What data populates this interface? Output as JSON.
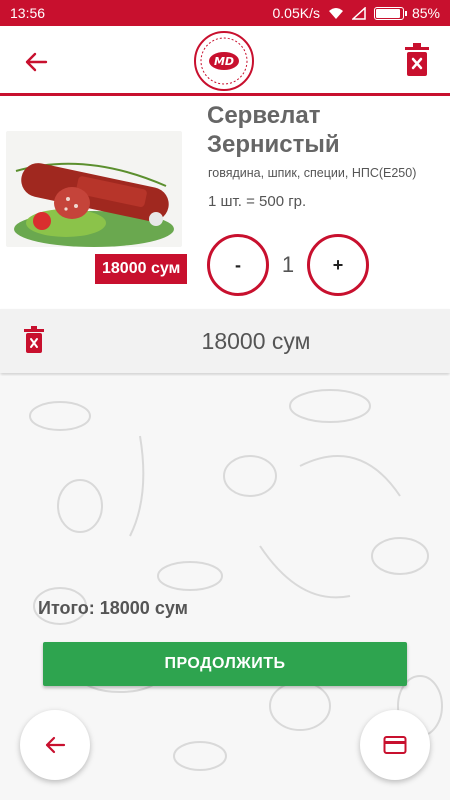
{
  "status_bar": {
    "time": "13:56",
    "network_speed": "0.05K/s",
    "battery": "85%",
    "battery_level": 0.85
  },
  "header": {
    "back_icon": "arrow-left-icon",
    "logo": "MD-logo",
    "clear_icon": "trash-icon"
  },
  "cart_item": {
    "name": "Сервелат Зернистый",
    "description": "говядина, шпик, специи, НПС(Е250)",
    "unit": "1 шт. = 500 гр.",
    "price": "18000 сум",
    "quantity": "1",
    "minus_label": "-",
    "plus_label": "+",
    "image": "servelat-product-photo"
  },
  "summary": {
    "sum": "18000 сум"
  },
  "total": {
    "label": "Итого: 18000 сум"
  },
  "continue_button": {
    "label": "ПРОДОЛЖИТЬ"
  },
  "fab": {
    "back_icon": "arrow-left-icon",
    "card_icon": "credit-card-icon"
  },
  "colors": {
    "brand_red": "#c8102e",
    "continue_green": "#2ea44f",
    "text_gray": "#555555"
  }
}
